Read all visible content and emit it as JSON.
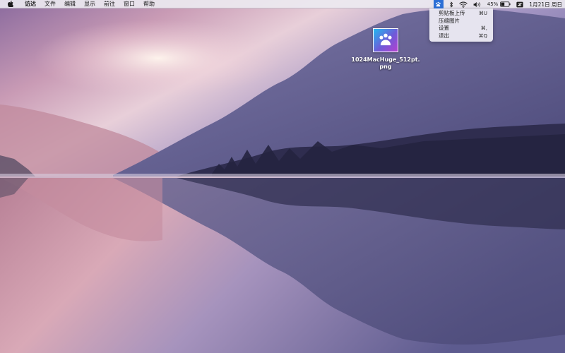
{
  "menubar": {
    "apple_icon": "apple-icon",
    "items": [
      "访达",
      "文件",
      "编辑",
      "显示",
      "前往",
      "窗口",
      "帮助"
    ],
    "status": {
      "app_icon": "paw-icon",
      "bluetooth_icon": "bluetooth-icon",
      "wifi_icon": "wifi-icon",
      "volume_icon": "volume-icon",
      "battery_percent": "45%",
      "battery_level": 0.45,
      "keyboard_icon": "input-source-icon",
      "clock": "1月21日 周日"
    }
  },
  "dropdown": {
    "items": [
      {
        "label": "剪贴板上传",
        "shortcut": "⌘U"
      },
      {
        "label": "压缩图片",
        "shortcut": ""
      },
      {
        "label": "设置",
        "shortcut": "⌘,"
      },
      {
        "label": "退出",
        "shortcut": "⌘Q"
      }
    ]
  },
  "desktop": {
    "file": {
      "name": "1024MacHuge_512pt.png",
      "icon": "paw-icon"
    }
  },
  "colors": {
    "menu_highlight": "#2b6fd6",
    "file_gradient_start": "#22b8f0",
    "file_gradient_end": "#b43fd0"
  }
}
